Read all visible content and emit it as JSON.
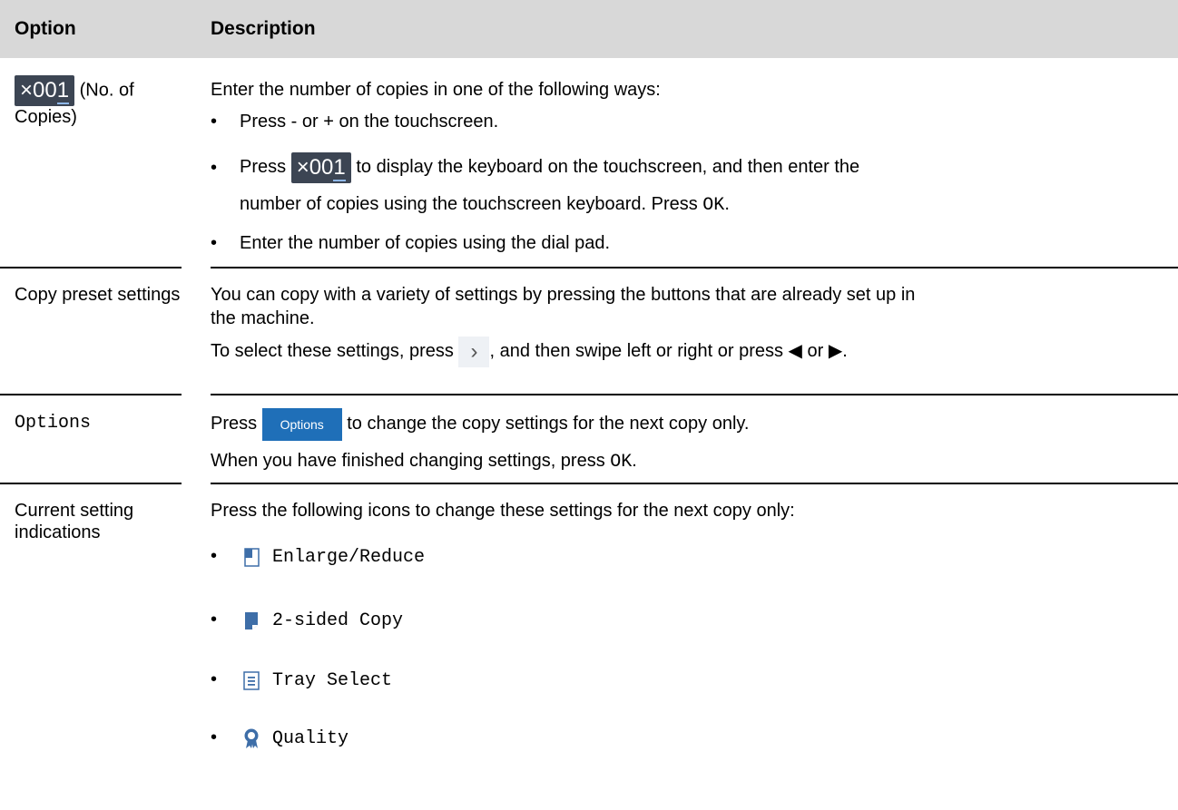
{
  "table": {
    "headers": {
      "option": "Option",
      "description": "Description"
    },
    "copies": {
      "button_prefix": "×00",
      "button_last": "1",
      "label": "(No. of Copies)",
      "intro": "Enter the number of copies in one of the following ways:",
      "bullet1": "Press - or + on the touchscreen.",
      "bullet2_pre": "Press",
      "bullet2_post": "to display the keyboard on the touchscreen, and then enter the",
      "bullet2_cont_pre": "number of copies using the touchscreen keyboard. Press",
      "bullet2_ok": "OK",
      "bullet2_end": ".",
      "bullet3": "Enter the number of copies using the dial pad."
    },
    "preset": {
      "label": "Copy preset settings",
      "line1": "You can copy with a variety of settings by pressing the buttons that are already set up in",
      "line2": "the machine.",
      "line3_pre": "To select these settings, press",
      "line3_post": ", and then swipe left or right or press ◀ or ▶."
    },
    "options": {
      "label": "Options",
      "line1_pre": "Press",
      "button": "Options",
      "line1_post": "to change the copy settings for the next copy only.",
      "line2_pre": "When you have finished changing settings, press",
      "line2_ok": "OK",
      "line2_end": "."
    },
    "current": {
      "label": "Current setting indications",
      "intro": "Press the following icons to change these settings for the next copy only:",
      "items": [
        {
          "icon": "enlarge-reduce-icon",
          "label": "Enlarge/Reduce"
        },
        {
          "icon": "two-sided-copy-icon",
          "label": "2-sided Copy"
        },
        {
          "icon": "tray-select-icon",
          "label": "Tray Select"
        },
        {
          "icon": "quality-icon",
          "label": "Quality"
        }
      ]
    }
  },
  "colors": {
    "header_bg": "#d8d8d8",
    "copies_button_bg": "#3c4553",
    "options_button_bg": "#1f6fb8"
  },
  "bullet_char": "•"
}
